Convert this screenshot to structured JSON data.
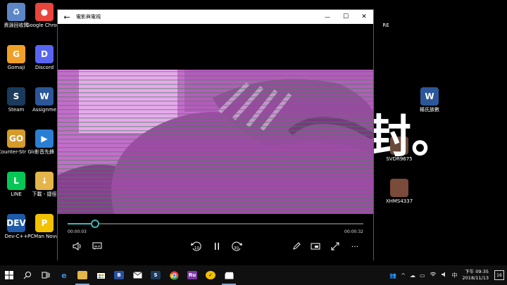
{
  "desktop": {
    "icons": [
      {
        "label": "資源回收筒",
        "name": "recycle-bin-icon",
        "color": "#5c86c5",
        "glyph": "♻"
      },
      {
        "label": "Google Chrome",
        "name": "chrome-icon",
        "color": "#e8453c",
        "glyph": "●"
      },
      {
        "label": "Gomaji",
        "name": "gomaji-icon",
        "color": "#f0a028",
        "glyph": "G"
      },
      {
        "label": "Discord",
        "name": "discord-icon",
        "color": "#5865f2",
        "glyph": "D"
      },
      {
        "label": "Steam",
        "name": "steam-icon",
        "color": "#1b3a5c",
        "glyph": "S"
      },
      {
        "label": "Assignme",
        "name": "word-document-icon",
        "color": "#2b579a",
        "glyph": "W"
      },
      {
        "label": "Counter-Str Global Off...",
        "name": "csgo-icon",
        "color": "#d49a2a",
        "glyph": "GO"
      },
      {
        "label": "影音先鋒",
        "name": "media-player-icon",
        "color": "#2a7fd4",
        "glyph": "▶"
      },
      {
        "label": "LINE",
        "name": "line-icon",
        "color": "#06c755",
        "glyph": "L"
      },
      {
        "label": "下載 - 捷徑",
        "name": "downloads-folder-icon",
        "color": "#e3b54a",
        "glyph": "↓"
      },
      {
        "label": "Dev-C++",
        "name": "devcpp-icon",
        "color": "#1e5aa8",
        "glyph": "DEV"
      },
      {
        "label": "PCMan Novus",
        "name": "pcman-icon",
        "color": "#f2c100",
        "glyph": "P"
      },
      {
        "label": "楊氏族數",
        "name": "word-document-icon-2",
        "color": "#2b579a",
        "glyph": "W"
      },
      {
        "label": "SVDR9675",
        "name": "video-thumbnail-icon",
        "color": "#6a4a3a",
        "glyph": ""
      },
      {
        "label": "XHMS4337",
        "name": "video-thumbnail-icon-2",
        "color": "#7a4a3a",
        "glyph": ""
      },
      {
        "label": "RE",
        "name": "partial-icon",
        "color": "#000000",
        "glyph": ""
      }
    ],
    "calligraphy": "封。"
  },
  "player": {
    "title": "電影與電視",
    "back_glyph": "←",
    "minimize_glyph": "—",
    "maximize_glyph": "☐",
    "close_glyph": "✕",
    "current_time": "00:00:03",
    "total_time": "00:00:32",
    "progress": 0.094,
    "skip_back_label": "10",
    "skip_forward_label": "30",
    "more_glyph": "···",
    "accent": "#3fb6b6"
  },
  "taskbar": {
    "clock_time": "下午 09:35",
    "clock_date": "2018/11/13",
    "notification_count": "16",
    "tray_lang": "中"
  }
}
